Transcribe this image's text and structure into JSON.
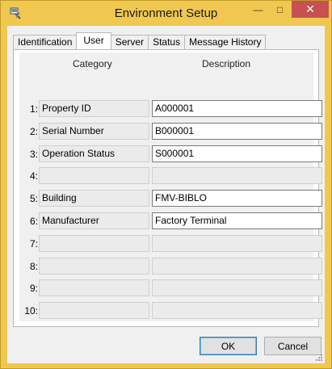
{
  "window": {
    "title": "Environment Setup",
    "icon": "settings-tools-icon",
    "minimize_glyph": "—",
    "maximize_glyph": "□",
    "close_glyph": "✕",
    "title_bar_color": "#f0c850",
    "close_color": "#c75050"
  },
  "tabs": [
    {
      "label": "Identification",
      "active": false
    },
    {
      "label": "User",
      "active": true
    },
    {
      "label": "Server",
      "active": false
    },
    {
      "label": "Status",
      "active": false
    },
    {
      "label": "Message History",
      "active": false
    }
  ],
  "table": {
    "category_header": "Category",
    "description_header": "Description",
    "rows": [
      {
        "num": "1:",
        "category": "Property ID",
        "description": "A000001"
      },
      {
        "num": "2:",
        "category": "Serial Number",
        "description": "B000001"
      },
      {
        "num": "3:",
        "category": "Operation Status",
        "description": "S000001"
      },
      {
        "num": "4:",
        "category": "",
        "description": ""
      },
      {
        "num": "5:",
        "category": "Building",
        "description": "FMV-BIBLO"
      },
      {
        "num": "6:",
        "category": "Manufacturer",
        "description": "Factory Terminal"
      },
      {
        "num": "7:",
        "category": "",
        "description": ""
      },
      {
        "num": "8:",
        "category": "",
        "description": ""
      },
      {
        "num": "9:",
        "category": "",
        "description": ""
      },
      {
        "num": "10:",
        "category": "",
        "description": ""
      }
    ]
  },
  "buttons": {
    "ok_label": "OK",
    "cancel_label": "Cancel"
  }
}
